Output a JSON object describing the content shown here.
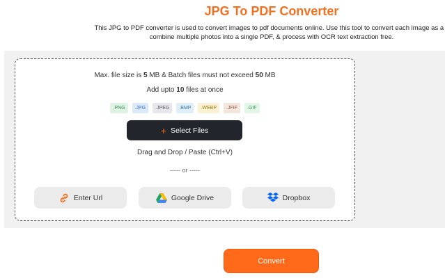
{
  "header": {
    "title": "JPG To PDF Converter",
    "description_line1": "This JPG to PDF converter is used to convert images to pdf documents online. Use this tool to convert each image as a s",
    "description_line2": "combine multiple photos into a single PDF, & process with OCR text extraction free."
  },
  "dropzone": {
    "limits": {
      "prefix": "Max. file size is ",
      "max_size": "5",
      "mid": " MB & Batch files must not exceed ",
      "batch_size": "50",
      "suffix": " MB"
    },
    "count": {
      "prefix": "Add upto ",
      "max_files": "10",
      "suffix": " files at once"
    },
    "formats": [
      {
        "label": ".PNG",
        "bg": "#dff3e4",
        "color": "#3a8a4c"
      },
      {
        "label": ".JPG",
        "bg": "#dbe9fb",
        "color": "#3470c4"
      },
      {
        "label": ".JPEG",
        "bg": "#e8e8ec",
        "color": "#5a5a66"
      },
      {
        "label": ".BMP",
        "bg": "#e0eef8",
        "color": "#3c7aa8"
      },
      {
        "label": ".WEBP",
        "bg": "#fbf2d6",
        "color": "#a27b12"
      },
      {
        "label": ".JFIF",
        "bg": "#f3e6dc",
        "color": "#8a5a3a"
      },
      {
        "label": ".GIF",
        "bg": "#e3f6e8",
        "color": "#3a9a5a"
      }
    ],
    "select_label": "Select Files",
    "drag_label": "Drag and Drop / Paste (Ctrl+V)",
    "or_label": "----- or -----",
    "sources": {
      "url_label": "Enter Url",
      "drive_label": "Google Drive",
      "dropbox_label": "Dropbox"
    }
  },
  "convert_label": "Convert",
  "colors": {
    "accent": "#f37021",
    "convert_bg": "#ff6a1a",
    "select_bg": "#22252b"
  }
}
